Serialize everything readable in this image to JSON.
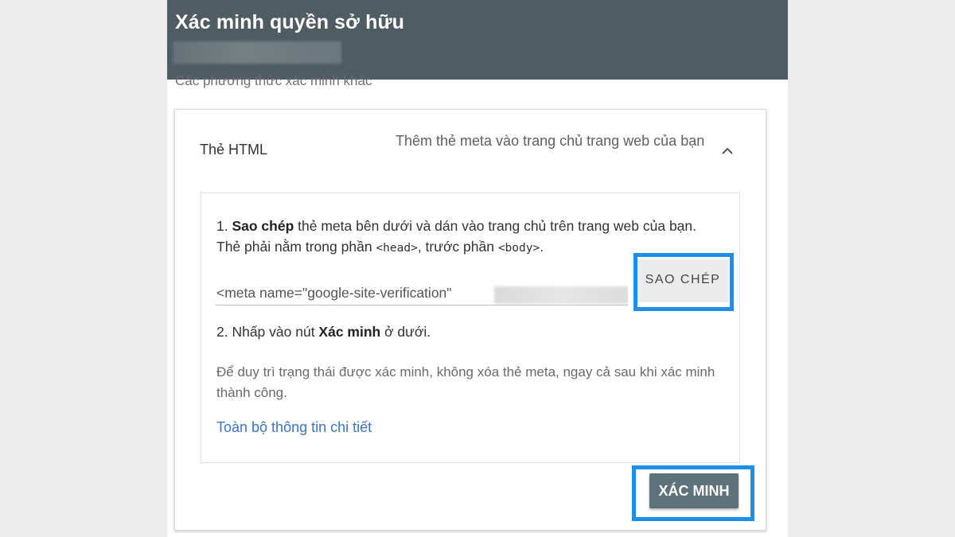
{
  "dialog": {
    "title": "Xác minh quyền sở hữu",
    "other_methods_label": "Các phương thức xác minh khác"
  },
  "method": {
    "name": "Thẻ HTML",
    "description": "Thêm thẻ meta vào trang chủ trang web của bạn",
    "collapse_icon": "chevron-up-icon"
  },
  "instructions": {
    "step1_bold": "Sao chép",
    "step1_prefix": "1. ",
    "step1_text_a": " thẻ meta bên dưới và dán vào trang chủ trên trang web của bạn. Thẻ phải nằm trong phần ",
    "step1_code_head": "<head>",
    "step1_text_b": ", trước phần ",
    "step1_code_body": "<body>",
    "step1_text_c": ".",
    "meta_tag_value": "<meta name=\"google-site-verification\"",
    "copy_button_label": "SAO CHÉP",
    "step2_prefix": "2. Nhấp vào nút ",
    "step2_bold": "Xác minh",
    "step2_suffix": " ở dưới.",
    "note": "Để duy trì trạng thái được xác minh, không xóa thẻ meta, ngay cả sau khi xác minh thành công.",
    "details_link": "Toàn bộ thông tin chi tiết"
  },
  "actions": {
    "verify_button_label": "XÁC MINH"
  },
  "colors": {
    "header_bg": "#4f5d63",
    "highlight": "#1f8ee6",
    "link": "#3a73c9",
    "verify_button": "#5e7279"
  }
}
